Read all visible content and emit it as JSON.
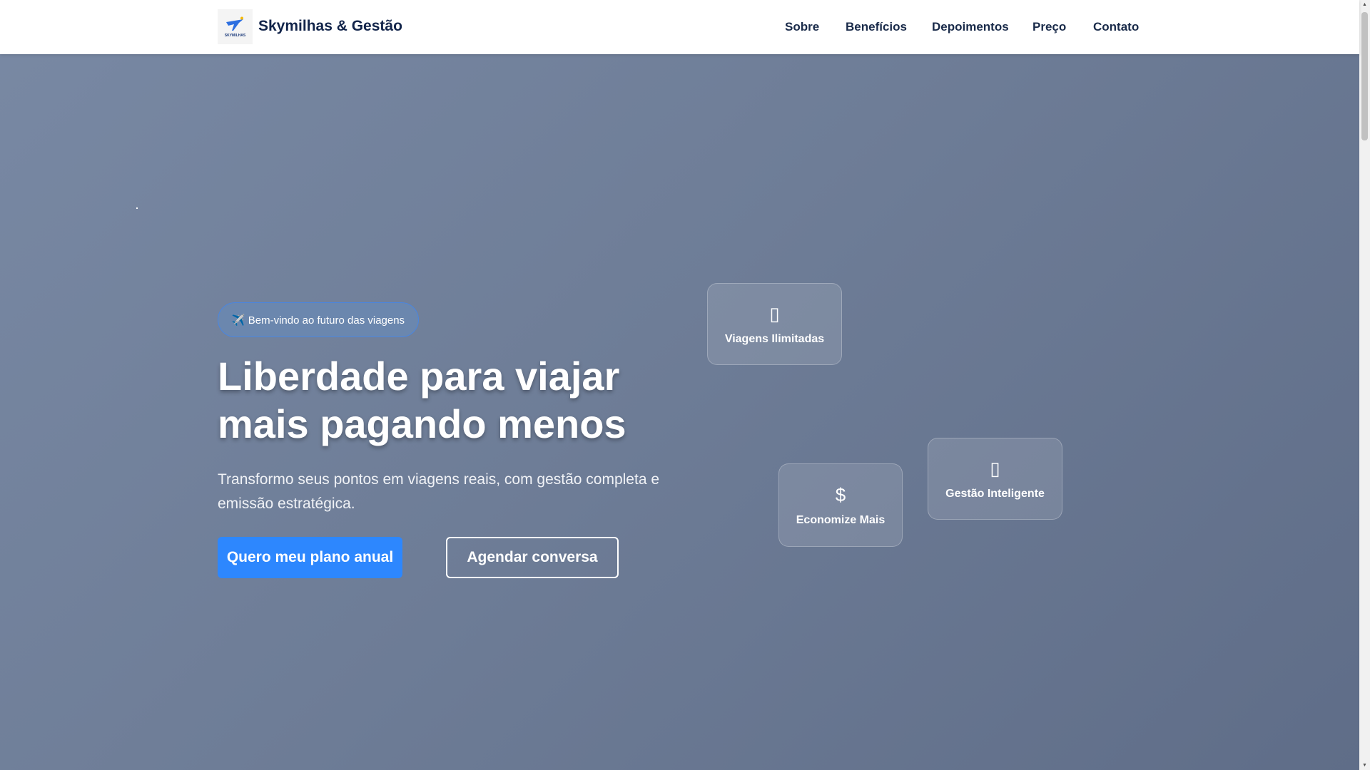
{
  "nav": {
    "brand": "Skymilhas & Gestão",
    "logo_text": "SKYMILHAS & GESTÃO",
    "links": [
      "Sobre",
      "Benefícios",
      "Depoimentos",
      "Preço",
      "Contato"
    ]
  },
  "hero": {
    "badge_icon": "airplane-icon",
    "badge": "✈️ Bem-vindo ao futuro das viagens",
    "title_line1": "Liberdade para viajar",
    "title_line2": "mais pagando menos",
    "subtitle": "Transformo seus pontos em viagens reais, com gestão completa e emissão estratégica.",
    "primary_cta": "Quero meu plano anual",
    "secondary_cta": "Agendar conversa"
  },
  "cards": [
    {
      "icon": "",
      "label": "Viagens Ilimitadas"
    },
    {
      "icon": "$",
      "label": "Economize Mais"
    },
    {
      "icon": "",
      "label": "Gestão Inteligente"
    }
  ],
  "colors": {
    "primary": "#2d87fe",
    "nav_text": "#1a2b4a",
    "brand": "#12244a"
  }
}
